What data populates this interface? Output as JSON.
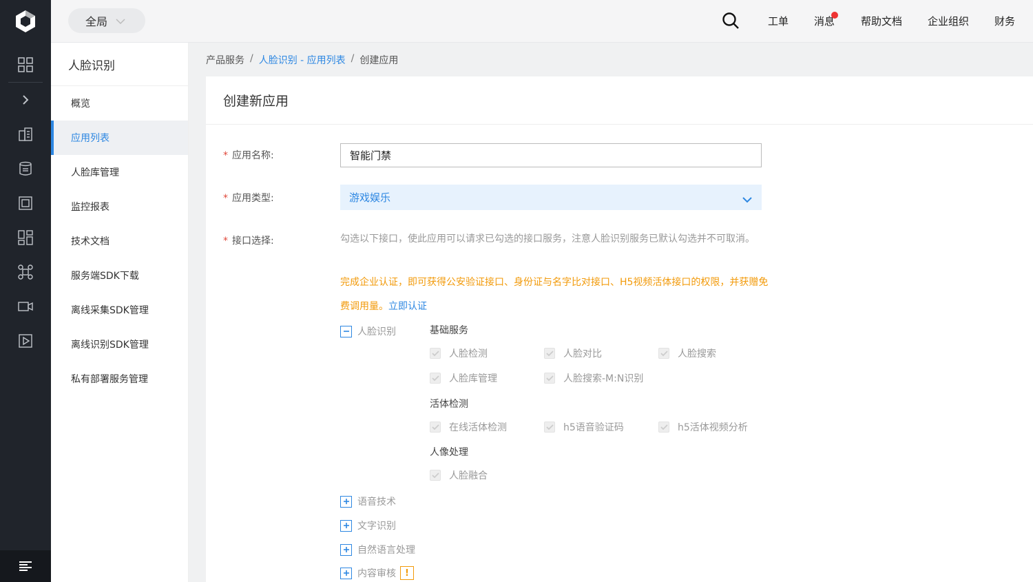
{
  "topbar": {
    "scope": "全局",
    "links": [
      "工单",
      "消息",
      "帮助文档",
      "企业组织",
      "财务"
    ]
  },
  "subnav": {
    "title": "人脸识别",
    "items": [
      {
        "label": "概览"
      },
      {
        "label": "应用列表"
      },
      {
        "label": "人脸库管理"
      },
      {
        "label": "监控报表"
      },
      {
        "label": "技术文档"
      },
      {
        "label": "服务端SDK下载"
      },
      {
        "label": "离线采集SDK管理"
      },
      {
        "label": "离线识别SDK管理"
      },
      {
        "label": "私有部署服务管理"
      }
    ]
  },
  "breadcrumb": {
    "root": "产品服务",
    "link": "人脸识别 - 应用列表",
    "current": "创建应用",
    "sep": "/"
  },
  "form": {
    "title": "创建新应用",
    "required_mark": "*",
    "name_label": "应用名称:",
    "name_value": "智能门禁",
    "type_label": "应用类型:",
    "type_value": "游戏娱乐",
    "api_label": "接口选择:",
    "hint": "勾选以下接口，使此应用可以请求已勾选的接口服务，注意人脸识别服务已默认勾选并不可取消。",
    "notice": "完成企业认证，即可获得公安验证接口、身份证与名字比对接口、H5视频活体接口的权限，并获赠免费调用量。",
    "verify_link": "立即认证",
    "face_group": "人脸识别",
    "categories": {
      "basic": {
        "title": "基础服务",
        "items": [
          "人脸检测",
          "人脸对比",
          "人脸搜索",
          "人脸库管理",
          "人脸搜索-M:N识别"
        ]
      },
      "liveness": {
        "title": "活体检测",
        "items": [
          "在线活体检测",
          "h5语音验证码",
          "h5活体视频分析"
        ]
      },
      "portrait": {
        "title": "人像处理",
        "items": [
          "人脸融合"
        ]
      }
    },
    "other_groups": [
      "语音技术",
      "文字识别",
      "自然语言处理",
      "内容审核"
    ],
    "warn_mark": "!"
  },
  "colors": {
    "accent": "#2d87e2",
    "warning": "#f29a0a",
    "required": "#e0493b",
    "rail": "#20242b"
  }
}
